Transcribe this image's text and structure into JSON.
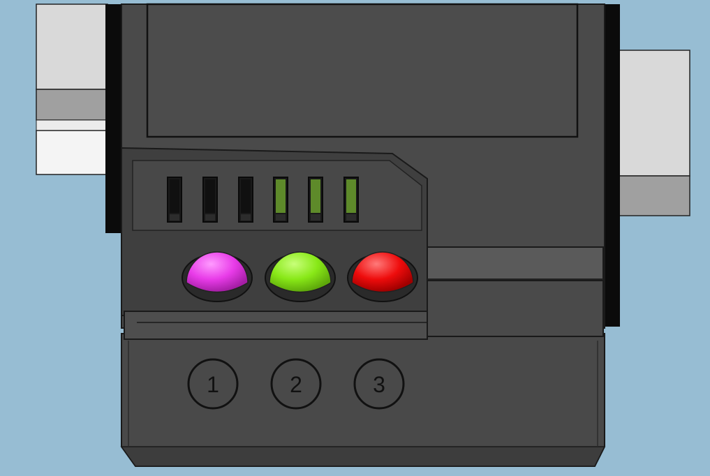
{
  "scene": {
    "background_color": "#97bdd3",
    "housing_color": "#4a4a4a",
    "housing_dark": "#2f2f2f",
    "connector_light": "#d9d9d9",
    "connector_mid": "#a0a0a0"
  },
  "indicator_bars": [
    {
      "id": 1,
      "state": "off",
      "color": "#101010"
    },
    {
      "id": 2,
      "state": "off",
      "color": "#101010"
    },
    {
      "id": 3,
      "state": "off",
      "color": "#101010"
    },
    {
      "id": 4,
      "state": "on",
      "color": "#5e8a2a"
    },
    {
      "id": 5,
      "state": "on",
      "color": "#5e8a2a"
    },
    {
      "id": 6,
      "state": "on",
      "color": "#5e8a2a"
    }
  ],
  "leds": [
    {
      "id": 1,
      "color": "#e83be8",
      "highlight": "#ff9bff"
    },
    {
      "id": 2,
      "color": "#88e817",
      "highlight": "#c8ff7a"
    },
    {
      "id": 3,
      "color": "#ee0c0c",
      "highlight": "#ff7a7a"
    }
  ],
  "buttons": [
    {
      "label": "1"
    },
    {
      "label": "2"
    },
    {
      "label": "3"
    }
  ]
}
